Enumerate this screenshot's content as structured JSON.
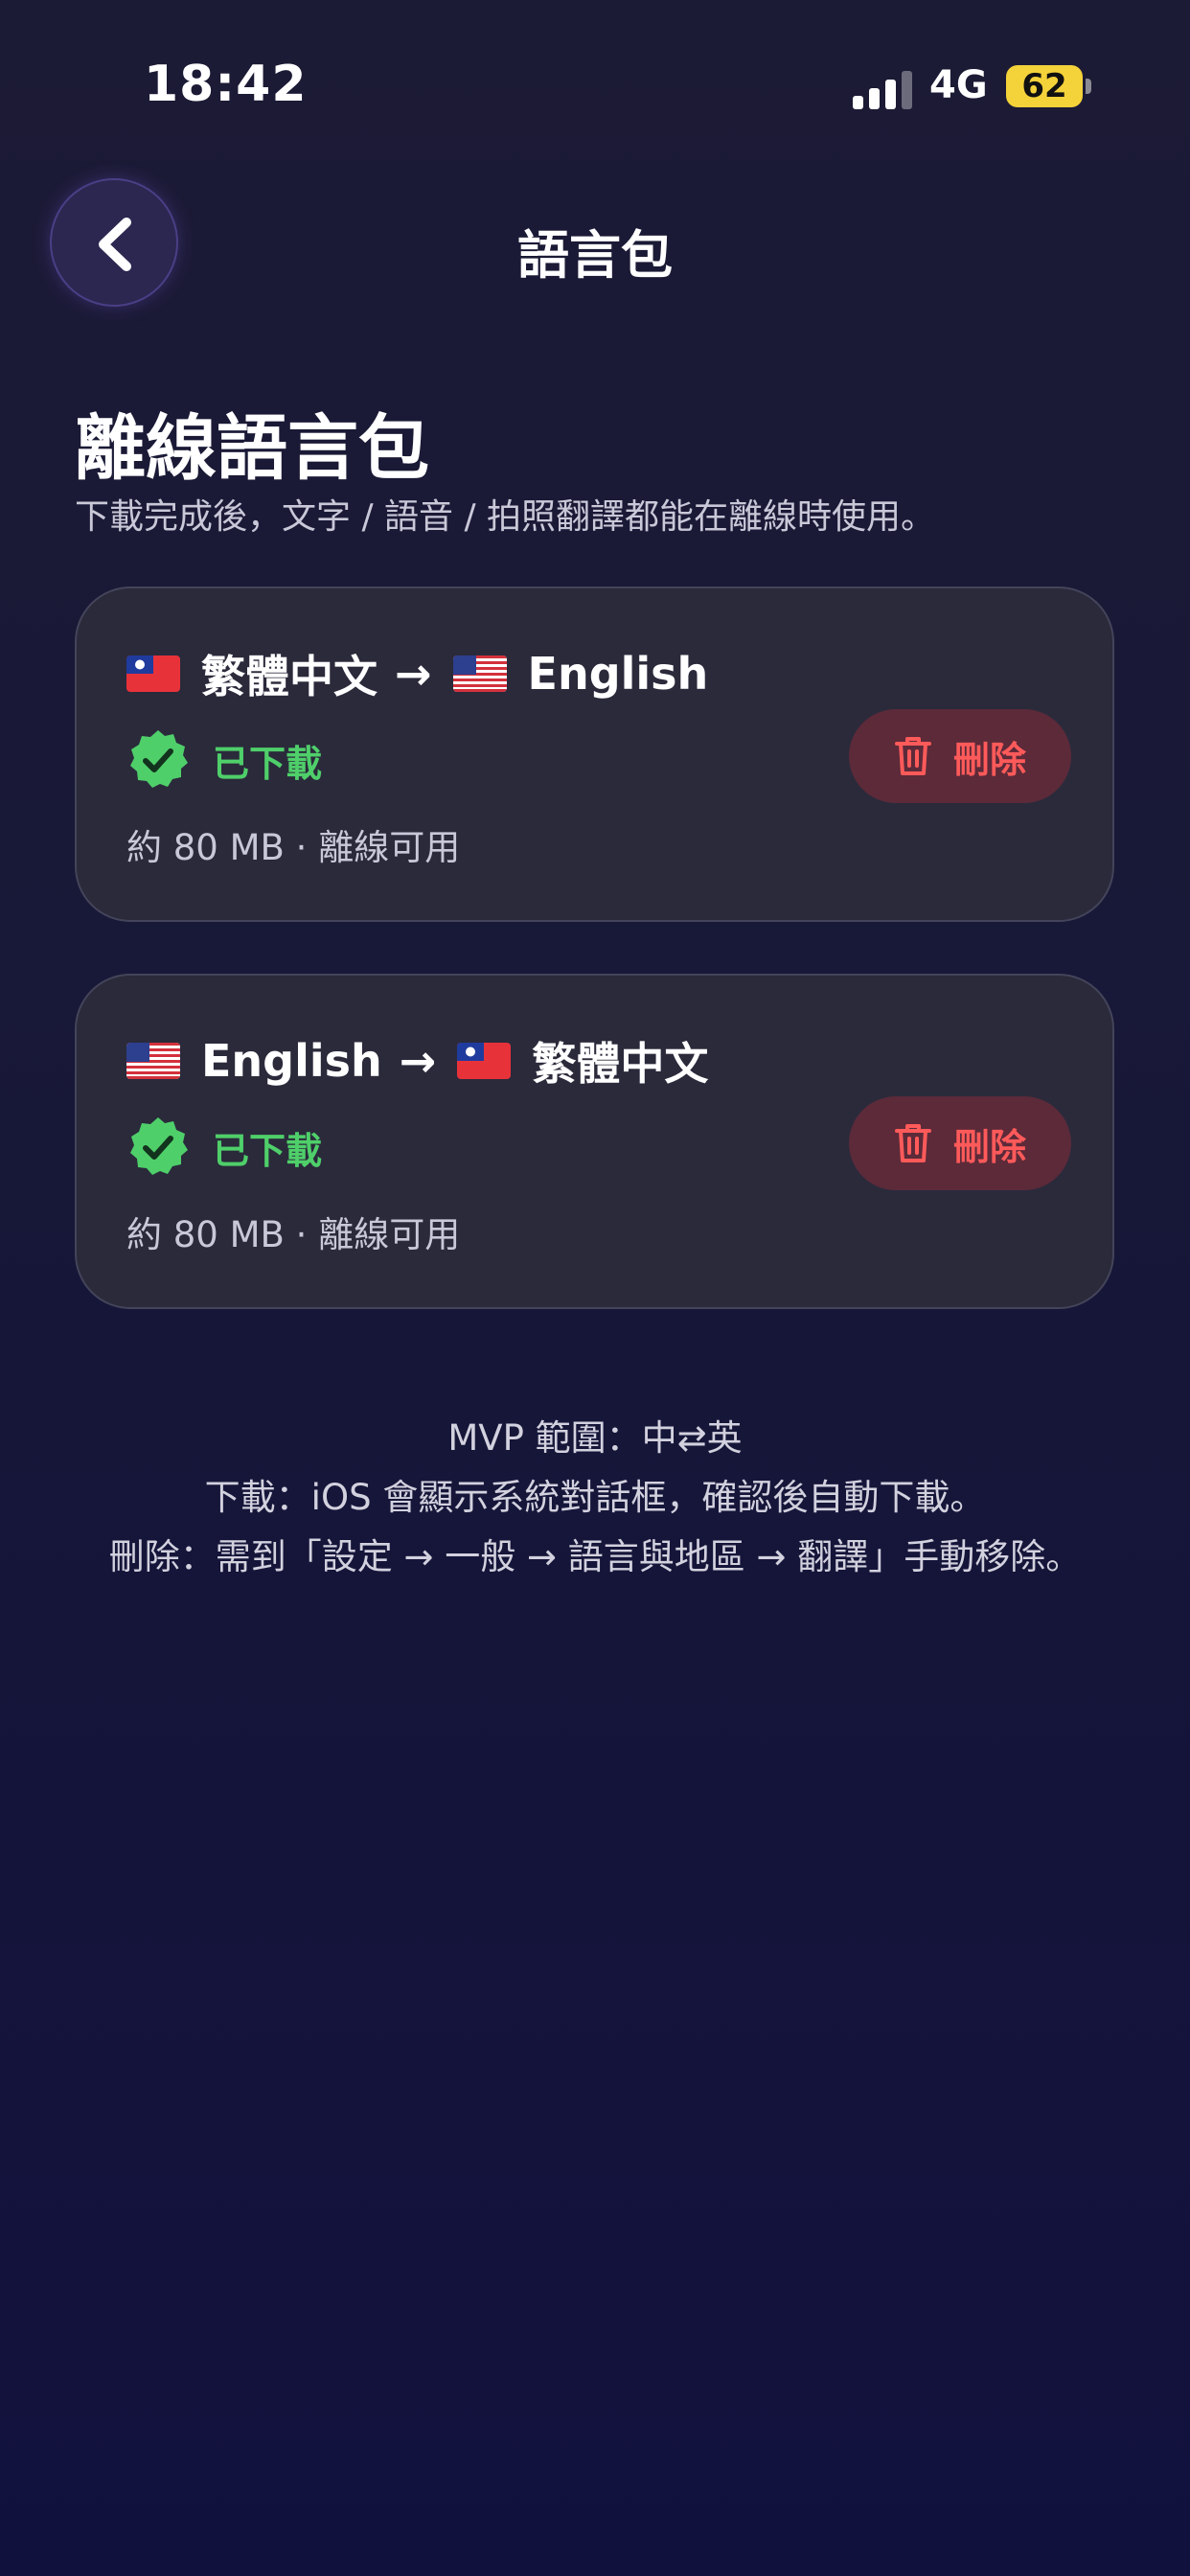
{
  "status_bar": {
    "time": "18:42",
    "network": "4G",
    "battery": "62"
  },
  "nav": {
    "title": "語言包",
    "back_icon": "chevron-left-icon"
  },
  "section": {
    "title": "離線語言包",
    "subtitle": "下載完成後，文字 / 語音 / 拍照翻譯都能在離線時使用。"
  },
  "packs": [
    {
      "source": "繁體中文",
      "arrow": "→",
      "target": "English",
      "source_flag": "taiwan-flag-icon",
      "target_flag": "us-flag-icon",
      "status": "已下載",
      "size": "約 80 MB · 離線可用",
      "delete_label": "刪除"
    },
    {
      "source": "English",
      "arrow": "→",
      "target": "繁體中文",
      "source_flag": "us-flag-icon",
      "target_flag": "taiwan-flag-icon",
      "status": "已下載",
      "size": "約 80 MB · 離線可用",
      "delete_label": "刪除"
    }
  ],
  "footer": {
    "line1": "MVP 範圍：中⇄英",
    "line2": "下載：iOS 會顯示系統對話框，確認後自動下載。",
    "line3": "刪除：需到「設定 → 一般 → 語言與地區 → 翻譯」手動移除。"
  },
  "colors": {
    "background": "#171738",
    "card": "#2a2a3b",
    "success": "#4fcf6a",
    "danger": "#ff5a5a",
    "danger_bg": "#5c2a39",
    "battery": "#f4d23a"
  }
}
